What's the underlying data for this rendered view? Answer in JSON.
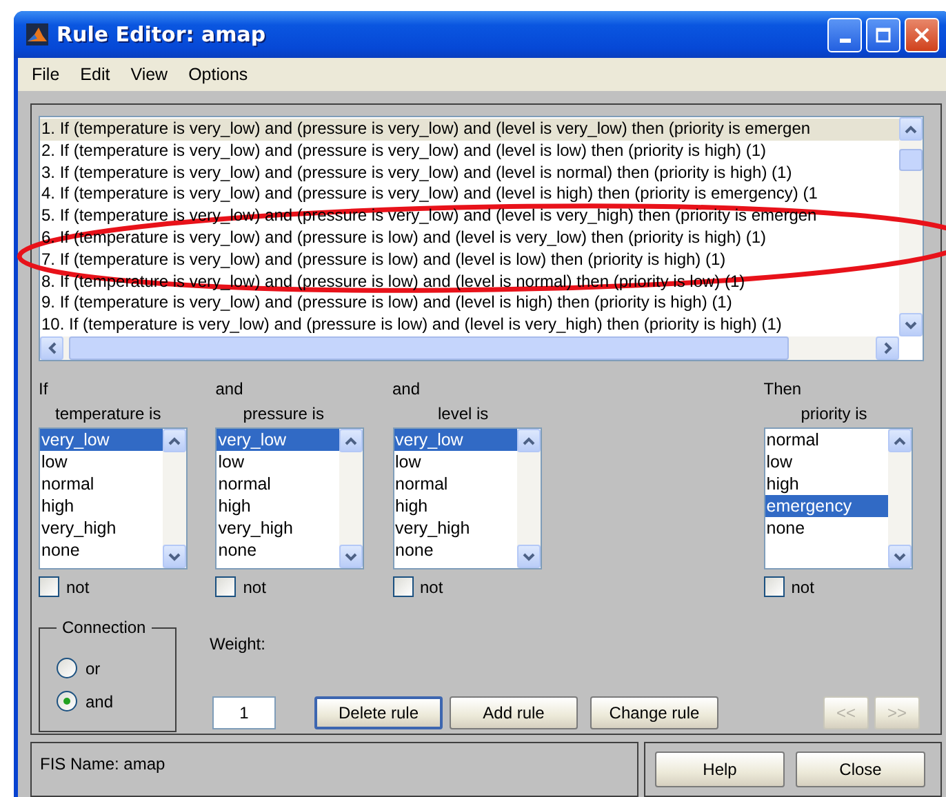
{
  "window": {
    "title": "Rule Editor: amap"
  },
  "menu": [
    "File",
    "Edit",
    "View",
    "Options"
  ],
  "rules": [
    {
      "text": "1. If (temperature is very_low) and (pressure is very_low) and (level is very_low) then (priority is emergen",
      "selected": true
    },
    {
      "text": "2. If (temperature is very_low) and (pressure is very_low) and (level is low) then (priority is high) (1)",
      "selected": false
    },
    {
      "text": "3. If (temperature is very_low) and (pressure is very_low) and (level is normal) then (priority is high) (1)",
      "selected": false
    },
    {
      "text": "4. If (temperature is very_low) and (pressure is very_low) and (level is high) then (priority is emergency) (1",
      "selected": false
    },
    {
      "text": "5. If (temperature is very_low) and (pressure is very_low) and (level is very_high) then (priority is emergen",
      "selected": false
    },
    {
      "text": "6. If (temperature is very_low) and (pressure is low) and (level is very_low) then (priority is high) (1)",
      "selected": false
    },
    {
      "text": "7. If (temperature is very_low) and (pressure is low) and (level is low) then (priority is high) (1)",
      "selected": false
    },
    {
      "text": "8. If (temperature is very_low) and (pressure is low) and (level is normal) then (priority is low) (1)",
      "selected": false
    },
    {
      "text": "9. If (temperature is very_low) and (pressure is low) and (level is high) then (priority is high) (1)",
      "selected": false
    },
    {
      "text": "10. If (temperature is very_low) and (pressure is low) and (level is very_high) then (priority is high) (1)",
      "selected": false
    }
  ],
  "variables": [
    {
      "kind": "input",
      "connector": "If",
      "label": "temperature is",
      "items": [
        {
          "label": "very_low",
          "selected": true
        },
        {
          "label": "low",
          "selected": false
        },
        {
          "label": "normal",
          "selected": false
        },
        {
          "label": "high",
          "selected": false
        },
        {
          "label": "very_high",
          "selected": false
        },
        {
          "label": "none",
          "selected": false
        }
      ],
      "not_label": "not",
      "not_checked": false
    },
    {
      "kind": "input",
      "connector": "and",
      "label": "pressure is",
      "items": [
        {
          "label": "very_low",
          "selected": true
        },
        {
          "label": "low",
          "selected": false
        },
        {
          "label": "normal",
          "selected": false
        },
        {
          "label": "high",
          "selected": false
        },
        {
          "label": "very_high",
          "selected": false
        },
        {
          "label": "none",
          "selected": false
        }
      ],
      "not_label": "not",
      "not_checked": false
    },
    {
      "kind": "input",
      "connector": "and",
      "label": "level is",
      "items": [
        {
          "label": "very_low",
          "selected": true
        },
        {
          "label": "low",
          "selected": false
        },
        {
          "label": "normal",
          "selected": false
        },
        {
          "label": "high",
          "selected": false
        },
        {
          "label": "very_high",
          "selected": false
        },
        {
          "label": "none",
          "selected": false
        }
      ],
      "not_label": "not",
      "not_checked": false
    },
    {
      "kind": "output",
      "connector": "Then",
      "label": "priority is",
      "items": [
        {
          "label": "normal",
          "selected": false
        },
        {
          "label": "low",
          "selected": false
        },
        {
          "label": "high",
          "selected": false
        },
        {
          "label": "emergency",
          "selected": true
        },
        {
          "label": "none",
          "selected": false
        }
      ],
      "not_label": "not",
      "not_checked": false
    }
  ],
  "connection": {
    "title": "Connection",
    "options": [
      {
        "label": "or",
        "selected": false
      },
      {
        "label": "and",
        "selected": true
      }
    ]
  },
  "weight": {
    "label": "Weight:",
    "value": "1"
  },
  "rule_buttons": [
    {
      "label": "Delete rule",
      "focused": true,
      "disabled": false
    },
    {
      "label": "Add rule",
      "focused": false,
      "disabled": false
    },
    {
      "label": "Change rule",
      "focused": false,
      "disabled": false
    }
  ],
  "nav_buttons": [
    {
      "label": "<<",
      "disabled": true
    },
    {
      "label": ">>",
      "disabled": true
    }
  ],
  "status": "FIS Name: amap",
  "footer_buttons": [
    "Help",
    "Close"
  ],
  "annotation": {
    "kind": "ellipse"
  }
}
